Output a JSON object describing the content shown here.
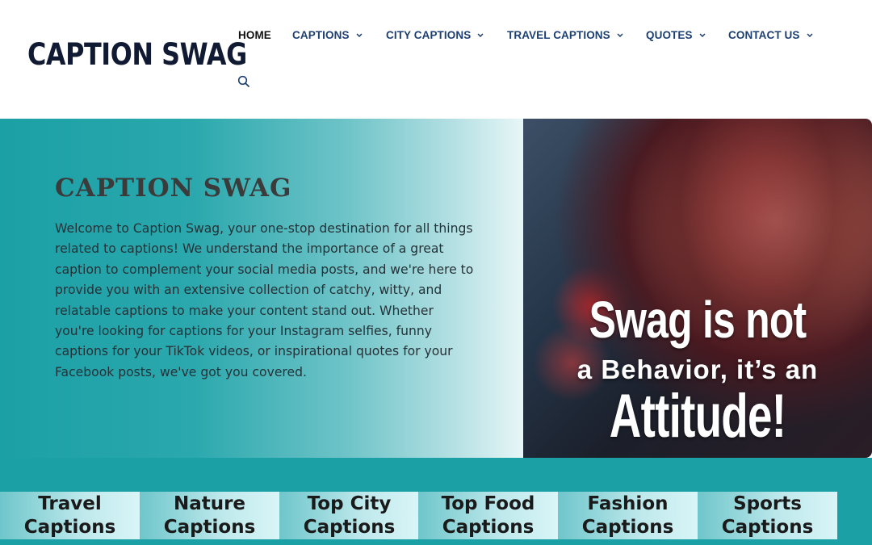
{
  "site": {
    "logo": "CAPTION SWAG"
  },
  "nav": {
    "items": [
      {
        "label": "HOME",
        "has_dropdown": false
      },
      {
        "label": "CAPTIONS",
        "has_dropdown": true
      },
      {
        "label": "CITY CAPTIONS",
        "has_dropdown": true
      },
      {
        "label": "TRAVEL CAPTIONS",
        "has_dropdown": true
      },
      {
        "label": "QUOTES",
        "has_dropdown": true
      },
      {
        "label": "CONTACT US",
        "has_dropdown": true
      }
    ],
    "search_icon": "search-icon",
    "colors": {
      "link": "#1c3f73",
      "active": "#111111"
    }
  },
  "hero": {
    "title": "CAPTION SWAG",
    "text": "Welcome to Caption Swag, your one-stop destination for all things related to captions! We understand the importance of a great caption to complement your social media posts, and we're here to provide you with an extensive collection of catchy, witty, and relatable captions to make your content stand out. Whether you're looking for captions for your Instagram selfies, funny captions for your TikTok videos, or inspirational quotes for your Facebook posts, we've got you covered.",
    "image": {
      "line1": "Swag is not",
      "line2": "a Behavior, it’s an",
      "line3": "Attitude!"
    }
  },
  "categories": [
    {
      "label": "Travel\nCaptions"
    },
    {
      "label": "Nature\nCaptions"
    },
    {
      "label": "Top City\nCaptions"
    },
    {
      "label": "Top Food\nCaptions"
    },
    {
      "label": "Fashion\nCaptions"
    },
    {
      "label": "Sports\nCaptions"
    }
  ],
  "colors": {
    "teal": "#1ba0a6",
    "logo": "#101a33"
  }
}
